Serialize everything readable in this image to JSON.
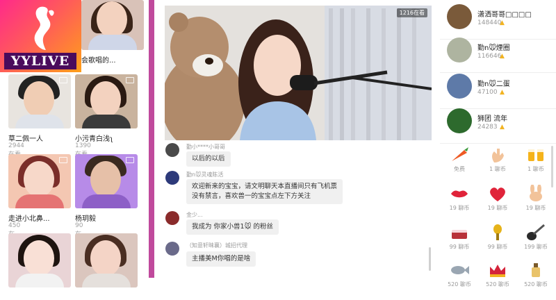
{
  "logo": {
    "text": "YYLIVE"
  },
  "streamers": [
    {
      "name": "会歌唱的...",
      "count": "",
      "thumb_color": "#d9c2b8"
    },
    {
      "name": "",
      "count": "",
      "thumb_color": "#efe6ea"
    },
    {
      "name": "草二佩一人",
      "count": "2944在看",
      "thumb_color": "#e8e4df"
    },
    {
      "name": "小污青白浅ʅ",
      "count": "1390在看",
      "thumb_color": "#c9b39e"
    },
    {
      "name": "走进小北鼻...",
      "count": "450在看",
      "thumb_color": "#f4c7b2"
    },
    {
      "name": "杨玥毅",
      "count": "90在看",
      "thumb_color": "#b78be8"
    },
    {
      "name": "",
      "count": "",
      "thumb_color": "#e9d4d6"
    },
    {
      "name": "",
      "count": "",
      "thumb_color": "#dbc6be"
    }
  ],
  "video": {
    "viewer_count": "1216在看"
  },
  "chat": [
    {
      "user": "勤小****小哥哥",
      "text": "以后的以后",
      "avatar_color": "#4a4a4a"
    },
    {
      "user": "勤n🐭灵魂陈活",
      "text": "欢迎新来的宝宝，请文明聊天本直播间只有飞机票\n没有禁言，喜欢兽一的宝宝点左下方关注",
      "avatar_color": "#2d3a7a"
    },
    {
      "user": "金少...",
      "text": "我成为 你家小兽1🐭 的粉丝",
      "avatar_color": "#8a2b2b"
    },
    {
      "user": "（知意轩昧襄）城招代理",
      "text": "主播美M你唱的是啥",
      "avatar_color": "#6a6a8a"
    }
  ],
  "ranking": [
    {
      "name": "潇洒哥哥□□□□",
      "score": "148440",
      "avatar_color": "#7a5a3a"
    },
    {
      "name": "勤n🐭煙圈",
      "score": "116646",
      "avatar_color": "#aeb4a0"
    },
    {
      "name": "勤n🐭二蛋",
      "score": "47100",
      "avatar_color": "#5e7aa8"
    },
    {
      "name": "狮团 流年",
      "score": "24283",
      "avatar_color": "#2d6a2d"
    }
  ],
  "gifts": [
    {
      "label": "免费",
      "icon": "carrot-icon"
    },
    {
      "label": "1 聊币",
      "icon": "hand-icon"
    },
    {
      "label": "1 聊币",
      "icon": "cheers-icon"
    },
    {
      "label": "19 聊币",
      "icon": "lips-icon"
    },
    {
      "label": "19 聊币",
      "icon": "heart-icon"
    },
    {
      "label": "19 聊币",
      "icon": "bunny-icon"
    },
    {
      "label": "99 聊币",
      "icon": "cake-icon"
    },
    {
      "label": "99 聊币",
      "icon": "microphone-icon"
    },
    {
      "label": "199 聊币",
      "icon": "guitar-icon"
    },
    {
      "label": "520 聊币",
      "icon": "fish-icon"
    },
    {
      "label": "520 聊币",
      "icon": "crown-icon"
    },
    {
      "label": "520 聊币",
      "icon": "perfume-icon"
    }
  ],
  "colors": {
    "accent": "#c04a9c",
    "coin": "#f2b321"
  }
}
